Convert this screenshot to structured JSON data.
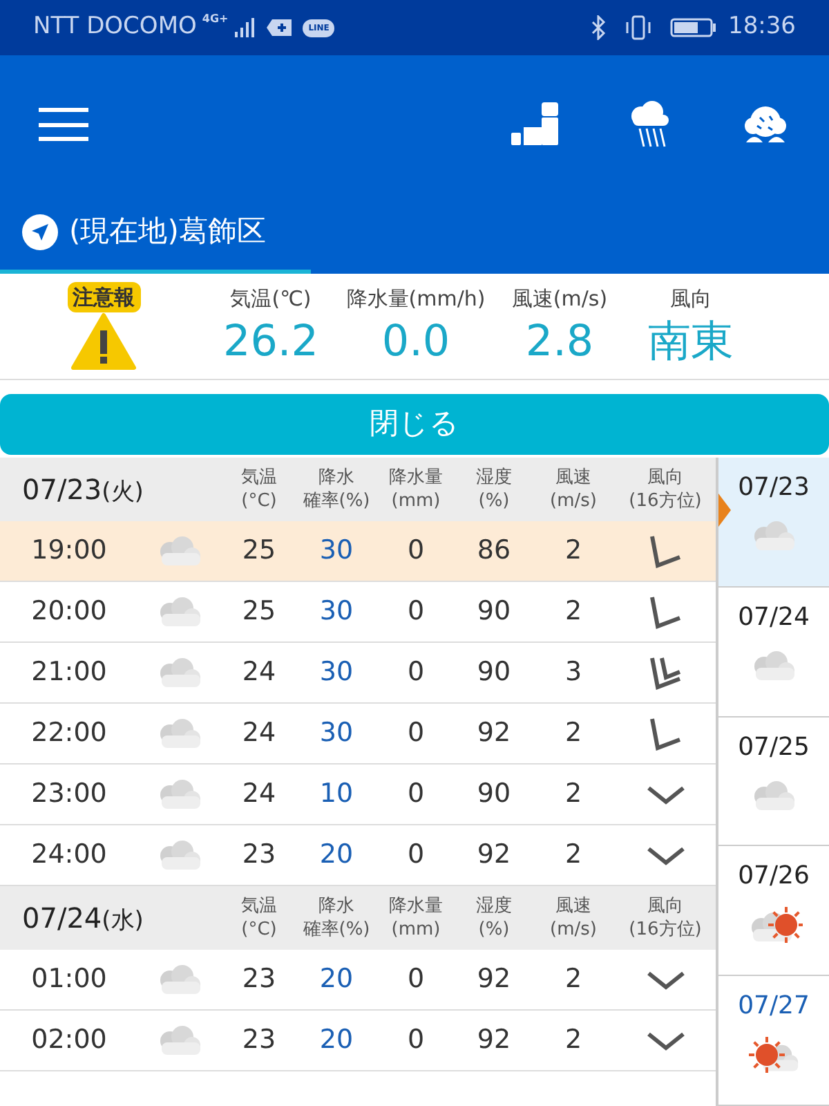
{
  "status_bar": {
    "carrier": "NTT DOCOMO",
    "network": "4G+",
    "app_badge": "LINE",
    "time": "18:36"
  },
  "location": {
    "label": "(現在地)葛飾区"
  },
  "current": {
    "alert": "注意報",
    "items": [
      {
        "label": "気温(℃)",
        "value": "26.2"
      },
      {
        "label": "降水量(mm/h)",
        "value": "0.0"
      },
      {
        "label": "風速(m/s)",
        "value": "2.8"
      },
      {
        "label": "風向",
        "value": "南東"
      }
    ]
  },
  "close_button": "閉じる",
  "days": [
    {
      "date": "07/23",
      "weekday": "(火)",
      "columns": [
        {
          "title": "気温",
          "unit": "(°C)"
        },
        {
          "title": "降水",
          "unit": "確率(%)"
        },
        {
          "title": "降水量",
          "unit": "(mm)"
        },
        {
          "title": "湿度",
          "unit": "(%)"
        },
        {
          "title": "風速",
          "unit": "(m/s)"
        },
        {
          "title": "風向",
          "unit": "(16方位)"
        }
      ],
      "rows": [
        {
          "time": "19:00",
          "weather": {
            "kind": "cloudy"
          },
          "temp": "25",
          "prob": "30",
          "amount": "0",
          "humidity": "86",
          "wind": "2",
          "wind_arrow": {
            "kind": "southwest"
          },
          "selected": true
        },
        {
          "time": "20:00",
          "weather": {
            "kind": "cloudy"
          },
          "temp": "25",
          "prob": "30",
          "amount": "0",
          "humidity": "90",
          "wind": "2",
          "wind_arrow": {
            "kind": "southwest"
          },
          "selected": false
        },
        {
          "time": "21:00",
          "weather": {
            "kind": "cloudy"
          },
          "temp": "24",
          "prob": "30",
          "amount": "0",
          "humidity": "90",
          "wind": "3",
          "wind_arrow": {
            "kind": "double"
          },
          "selected": false
        },
        {
          "time": "22:00",
          "weather": {
            "kind": "cloudy"
          },
          "temp": "24",
          "prob": "30",
          "amount": "0",
          "humidity": "92",
          "wind": "2",
          "wind_arrow": {
            "kind": "southwest"
          },
          "selected": false
        },
        {
          "time": "23:00",
          "weather": {
            "kind": "cloudy"
          },
          "temp": "24",
          "prob": "10",
          "amount": "0",
          "humidity": "90",
          "wind": "2",
          "wind_arrow": {
            "kind": "south"
          },
          "selected": false
        },
        {
          "time": "24:00",
          "weather": {
            "kind": "cloudy"
          },
          "temp": "23",
          "prob": "20",
          "amount": "0",
          "humidity": "92",
          "wind": "2",
          "wind_arrow": {
            "kind": "south"
          },
          "selected": false
        }
      ]
    },
    {
      "date": "07/24",
      "weekday": "(水)",
      "columns": [
        {
          "title": "気温",
          "unit": "(°C)"
        },
        {
          "title": "降水",
          "unit": "確率(%)"
        },
        {
          "title": "降水量",
          "unit": "(mm)"
        },
        {
          "title": "湿度",
          "unit": "(%)"
        },
        {
          "title": "風速",
          "unit": "(m/s)"
        },
        {
          "title": "風向",
          "unit": "(16方位)"
        }
      ],
      "rows": [
        {
          "time": "01:00",
          "weather": {
            "kind": "cloudy"
          },
          "temp": "23",
          "prob": "20",
          "amount": "0",
          "humidity": "92",
          "wind": "2",
          "wind_arrow": {
            "kind": "south"
          },
          "selected": false
        },
        {
          "time": "02:00",
          "weather": {
            "kind": "cloudy"
          },
          "temp": "23",
          "prob": "20",
          "amount": "0",
          "humidity": "92",
          "wind": "2",
          "wind_arrow": {
            "kind": "south"
          },
          "selected": false
        }
      ]
    }
  ],
  "week": [
    {
      "date": "07/23",
      "weather": {
        "kind": "cloudy"
      },
      "selected": true,
      "color": "#222222"
    },
    {
      "date": "07/24",
      "weather": {
        "kind": "cloudy"
      },
      "selected": false,
      "color": "#222222"
    },
    {
      "date": "07/25",
      "weather": {
        "kind": "cloudy"
      },
      "selected": false,
      "color": "#222222"
    },
    {
      "date": "07/26",
      "weather": {
        "kind": "cloudsun"
      },
      "selected": false,
      "color": "#222222"
    },
    {
      "date": "07/27",
      "weather": {
        "kind": "suncloud"
      },
      "selected": false,
      "color": "#1a5fb4"
    }
  ]
}
